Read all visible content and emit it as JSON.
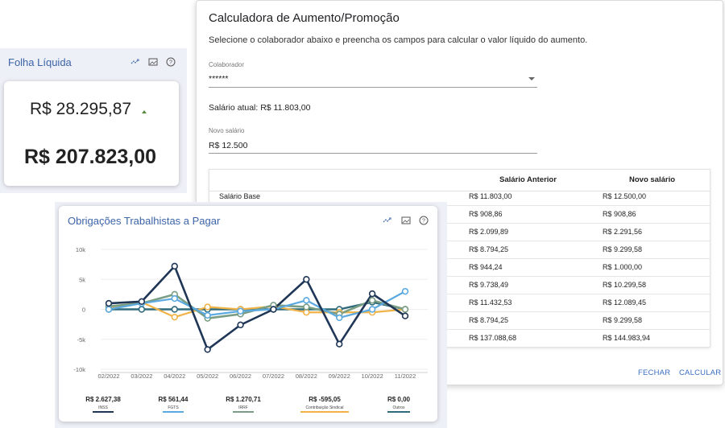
{
  "dialog": {
    "title": "Calculadora de Aumento/Promoção",
    "description": "Selecione o colaborador abaixo e preencha os campos para calcular o valor líquido do aumento.",
    "collaborator_label": "Colaborador",
    "collaborator_value": "******",
    "current_salary": "Salário atual: R$ 11.803,00",
    "new_salary_label": "Novo salário",
    "new_salary_value": "R$ 12.500",
    "table": {
      "headers": [
        "",
        "Salário Anterior",
        "Novo salário"
      ],
      "rows": [
        [
          "Salário Base",
          "R$ 11.803,00",
          "R$ 12.500,00"
        ],
        [
          "",
          "R$ 908,86",
          "R$ 908,86"
        ],
        [
          "",
          "R$ 2.099,89",
          "R$ 2.291,56"
        ],
        [
          "",
          "R$ 8.794,25",
          "R$ 9.299,58"
        ],
        [
          "",
          "R$ 944,24",
          "R$ 1.000,00"
        ],
        [
          "",
          "R$ 9.738,49",
          "R$ 10.299,58"
        ],
        [
          "",
          "R$ 11.432,53",
          "R$ 12.089,45"
        ],
        [
          "",
          "R$ 8.794,25",
          "R$ 9.299,58"
        ],
        [
          "",
          "R$ 137.088,68",
          "R$ 144.983,94"
        ]
      ]
    },
    "buttons": {
      "close": "FECHAR",
      "calculate": "CALCULAR"
    }
  },
  "folha": {
    "title": "Folha Líquida",
    "value_small": "R$ 28.295,87",
    "value_big": "R$ 207.823,00"
  },
  "obrigacoes": {
    "title": "Obrigações Trabalhistas a Pagar",
    "summary": [
      {
        "value": "R$ 2.627,38",
        "label": "INSS"
      },
      {
        "value": "R$ 561,44",
        "label": "FGTS"
      },
      {
        "value": "R$ 1.270,71",
        "label": "IRRF"
      },
      {
        "value": "R$ -595,05",
        "label": "Contribuição Sindical"
      },
      {
        "value": "R$ 0,00",
        "label": "Outros"
      }
    ]
  },
  "colors": {
    "INSS": "#1f3657",
    "FGTS": "#5aa9e0",
    "IRRF": "#7a9e84",
    "Contribuição Sindical": "#f0b348",
    "Outros": "#2f6b7c",
    "title_blue": "#3c64a8",
    "button_blue": "#3b6fc0"
  },
  "icons": [
    "trend-icon",
    "image-icon",
    "help-icon"
  ],
  "chart_data": {
    "type": "line",
    "categories": [
      "02/2022",
      "03/2022",
      "04/2022",
      "05/2022",
      "06/2022",
      "07/2022",
      "08/2022",
      "09/2022",
      "10/2022",
      "11/2022"
    ],
    "y_ticks": [
      "10k",
      "5k",
      "0",
      "-5k",
      "-10k"
    ],
    "ylim": [
      -10000,
      10000
    ],
    "series": [
      {
        "name": "Outros",
        "values": [
          0,
          0,
          0,
          0,
          0,
          0,
          0,
          0,
          1200,
          0
        ]
      },
      {
        "name": "Contribuição Sindical",
        "values": [
          300,
          1200,
          -1300,
          400,
          0,
          500,
          -500,
          -500,
          -500,
          0
        ]
      },
      {
        "name": "IRRF",
        "values": [
          500,
          1000,
          2500,
          -1500,
          -800,
          700,
          400,
          -800,
          1500,
          0
        ]
      },
      {
        "name": "FGTS",
        "values": [
          0,
          1000,
          1800,
          -1000,
          -300,
          0,
          1500,
          -1400,
          0,
          3000
        ]
      },
      {
        "name": "INSS",
        "values": [
          1000,
          1300,
          7200,
          -6700,
          -2600,
          0,
          5000,
          -5800,
          2600,
          -1100
        ]
      }
    ]
  }
}
